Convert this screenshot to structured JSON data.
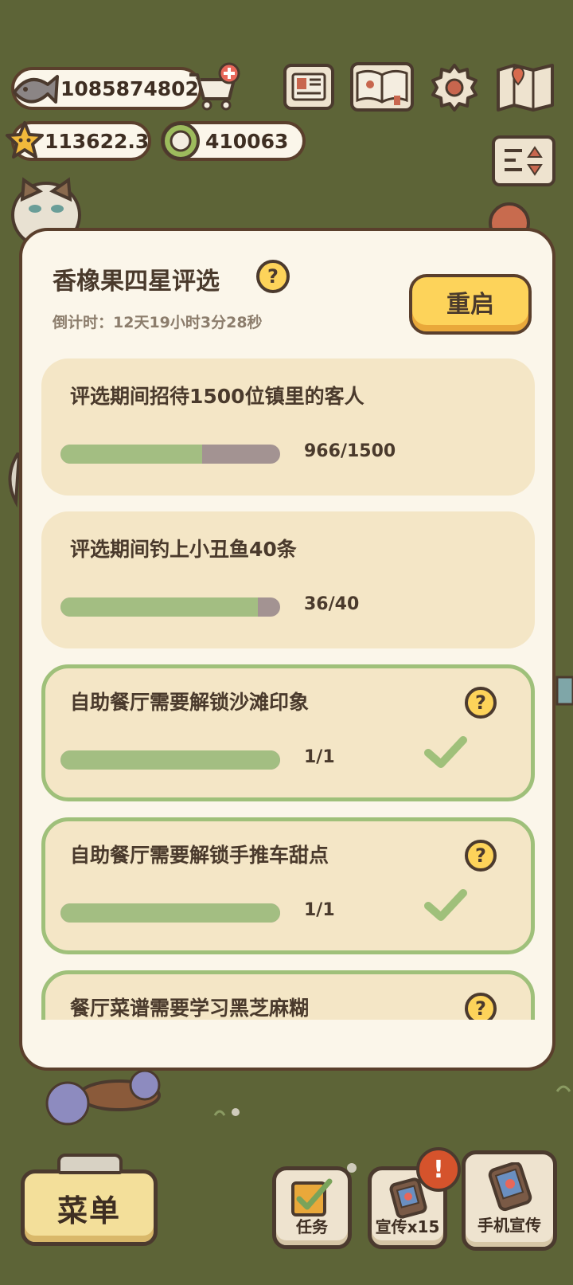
{
  "currency": {
    "fish": "1085874802",
    "stars": "113622.3",
    "coins": "410063"
  },
  "panel": {
    "title": "香橡果四星评选",
    "countdown": "倒计时：12天19小时3分28秒",
    "restart_label": "重启",
    "help_glyph": "?"
  },
  "tasks": [
    {
      "text": "评选期间招待1500位镇里的客人",
      "progress": "966/1500",
      "fraction": 0.644,
      "done": false
    },
    {
      "text": "评选期间钓上小丑鱼40条",
      "progress": "36/40",
      "fraction": 0.9,
      "done": false
    },
    {
      "text": "自助餐厅需要解锁沙滩印象",
      "progress": "1/1",
      "fraction": 1.0,
      "done": true
    },
    {
      "text": "自助餐厅需要解锁手推车甜点",
      "progress": "1/1",
      "fraction": 1.0,
      "done": true
    },
    {
      "text": "餐厅菜谱需要学习黑芝麻糊",
      "progress": "",
      "fraction": null,
      "done": false
    }
  ],
  "bottom": {
    "menu_label": "菜单",
    "tasks_label": "任务",
    "promo_label": "宣传x15",
    "phone_promo_label": "手机宣传",
    "badge_glyph": "!"
  },
  "colors": {
    "background": "#5d6437",
    "panel": "#fbf6ea",
    "card": "#f4e6c6",
    "bar_fill": "#a3be82",
    "bar_track": "#a39392",
    "accent_yellow": "#fdd35a",
    "done_border": "#9fc07a",
    "badge": "#d5532c"
  },
  "icons": [
    "fish-icon",
    "shop-cart-icon",
    "star-icon",
    "coin-icon",
    "newspaper-icon",
    "book-icon",
    "gear-icon",
    "map-icon",
    "sort-icon",
    "help-icon",
    "check-icon",
    "task-icon",
    "promo-icon",
    "phone-icon"
  ]
}
